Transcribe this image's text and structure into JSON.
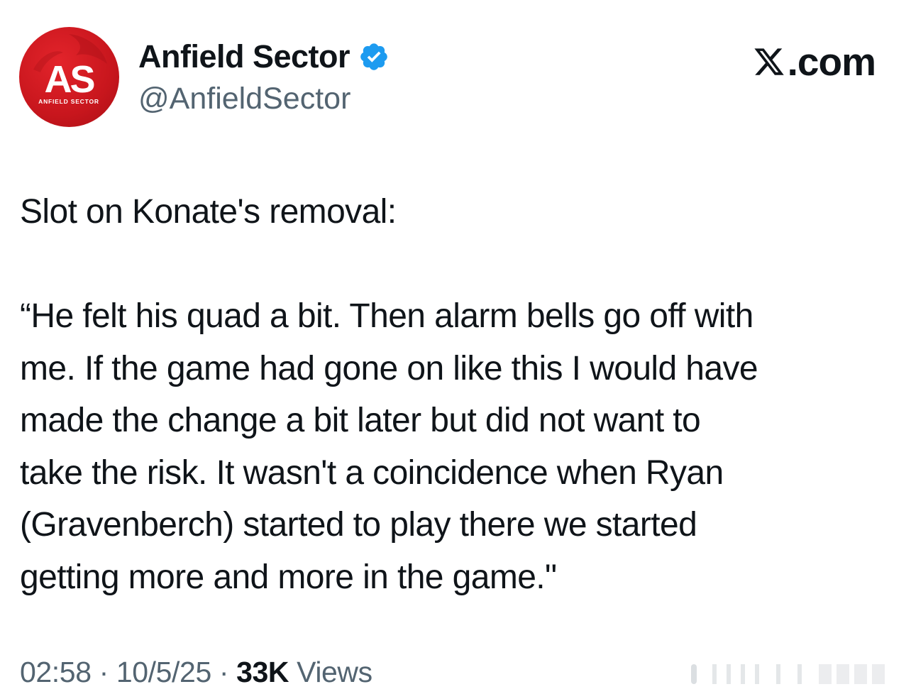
{
  "header": {
    "display_name": "Anfield Sector",
    "handle": "@AnfieldSector",
    "avatar_icon": "anfield-sector-logo",
    "verified_icon": "verified-badge-icon",
    "brand_icon": "x-logo-icon",
    "brand_text": ".com"
  },
  "avatar_logo_text": {
    "initials": "AS",
    "wordmark": "ANFIELD SECTOR"
  },
  "tweet": {
    "lines": [
      "Slot on Konate's removal:",
      "",
      "“He felt his quad a bit. Then alarm bells go off with",
      "me. If the game had gone on like this I would have",
      "made the change a bit later but did not want to",
      "take the risk. It wasn't a coincidence when Ryan",
      "(Gravenberch) started to play there we started",
      "getting more and more in the game.\""
    ]
  },
  "meta": {
    "time": "02:58",
    "separator": " · ",
    "date": "10/5/25",
    "views_count": "33K",
    "views_label": " Views"
  },
  "colors": {
    "text_primary": "#0f1419",
    "text_secondary": "#536471",
    "verified_blue": "#1d9bf0",
    "avatar_red": "#c8161d"
  }
}
